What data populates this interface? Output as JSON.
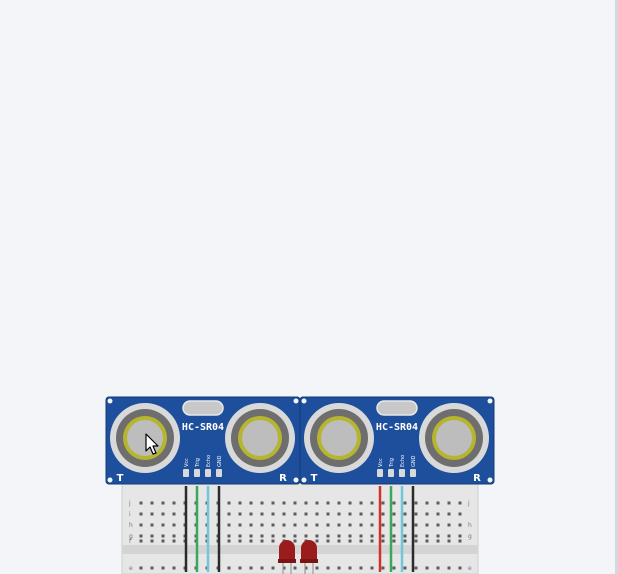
{
  "sensors": [
    {
      "label": "HC-SR04",
      "pins": [
        "Vcc",
        "Trig",
        "Echo",
        "GND"
      ],
      "left_mark": "T",
      "right_mark": "R"
    },
    {
      "label": "HC-SR04",
      "pins": [
        "Vcc",
        "Trig",
        "Echo",
        "GND"
      ],
      "left_mark": "T",
      "right_mark": "R"
    }
  ],
  "breadboard": {
    "row_letters_top": [
      "j",
      "i",
      "h",
      "g",
      "f"
    ],
    "row_letter_bottom": "e"
  },
  "colors": {
    "pcb_blue": "#1d4f9c",
    "canvas_bg": "#f3f5f8",
    "led_red": "#9b1c1c",
    "wire_red": "#d0322c",
    "wire_green": "#3aa85a",
    "wire_cyan": "#6fc7d8",
    "wire_black": "#2b2b2b"
  }
}
